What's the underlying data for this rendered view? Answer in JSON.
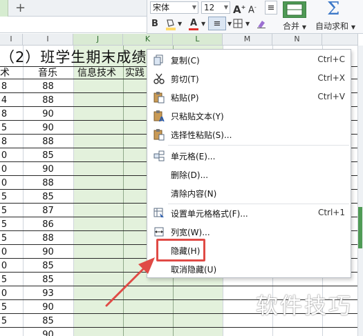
{
  "tabs": {
    "new_tab": "+"
  },
  "ribbon": {
    "font_name": "宋体",
    "font_size": "12",
    "grow_font": "A",
    "shrink_font": "A",
    "bold": "B",
    "font_color": "A",
    "merge_label": "合并",
    "autosum_label": "自动求和",
    "fill_color_hex": "#ffd966",
    "font_color_hex": "#e0302a"
  },
  "columns": [
    {
      "letter": "I",
      "selected": false
    },
    {
      "letter": "I",
      "selected": false
    },
    {
      "letter": "J",
      "selected": true
    },
    {
      "letter": "K",
      "selected": true
    },
    {
      "letter": "L",
      "selected": true
    },
    {
      "letter": "M",
      "selected": false
    },
    {
      "letter": "N",
      "selected": false
    }
  ],
  "sheet": {
    "title": "（2）班学生期末成绩",
    "headers": [
      "术",
      "音乐",
      "信息技术",
      "实践"
    ],
    "rows": [
      [
        "8",
        "88"
      ],
      [
        "4",
        "88"
      ],
      [
        "8",
        "90"
      ],
      [
        "5",
        "90"
      ],
      [
        "8",
        "88"
      ],
      [
        "0",
        "85"
      ],
      [
        "0",
        "90"
      ],
      [
        "0",
        "88"
      ],
      [
        "5",
        "85"
      ],
      [
        "5",
        "87"
      ],
      [
        "5",
        "86"
      ],
      [
        "5",
        "88"
      ],
      [
        "0",
        "90"
      ],
      [
        "0",
        "85"
      ],
      [
        "5",
        "85"
      ],
      [
        "0",
        "93"
      ],
      [
        "5",
        "90"
      ],
      [
        "5",
        "85"
      ],
      [
        "",
        "90"
      ]
    ]
  },
  "context_menu": {
    "items": [
      {
        "label": "复制(C)",
        "shortcut": "Ctrl+C",
        "icon": "copy-icon"
      },
      {
        "label": "剪切(T)",
        "shortcut": "Ctrl+X",
        "icon": "scissors-icon"
      },
      {
        "label": "粘贴(P)",
        "shortcut": "Ctrl+V",
        "icon": "paste-icon"
      },
      {
        "label": "只粘贴文本(Y)",
        "shortcut": "",
        "icon": "paste-text-icon"
      },
      {
        "label": "选择性粘贴(S)...",
        "shortcut": "",
        "icon": "paste-special-icon"
      },
      {
        "label": "单元格(E)...",
        "shortcut": "",
        "icon": "cells-icon"
      },
      {
        "label": "删除(D)...",
        "shortcut": "",
        "icon": ""
      },
      {
        "label": "清除内容(N)",
        "shortcut": "",
        "icon": ""
      },
      {
        "label": "设置单元格格式(F)...",
        "shortcut": "Ctrl+1",
        "icon": "format-cells-icon"
      },
      {
        "label": "列宽(W)...",
        "shortcut": "",
        "icon": "column-width-icon"
      },
      {
        "label": "隐藏(H)",
        "shortcut": "",
        "icon": ""
      },
      {
        "label": "取消隐藏(U)",
        "shortcut": "",
        "icon": ""
      }
    ],
    "highlighted_label": "隐藏(H)"
  },
  "watermark": "软件技巧",
  "colors": {
    "selection_green": "#e3f1dc",
    "highlight_red": "#e04a45",
    "accent_green": "#4f9a55"
  }
}
